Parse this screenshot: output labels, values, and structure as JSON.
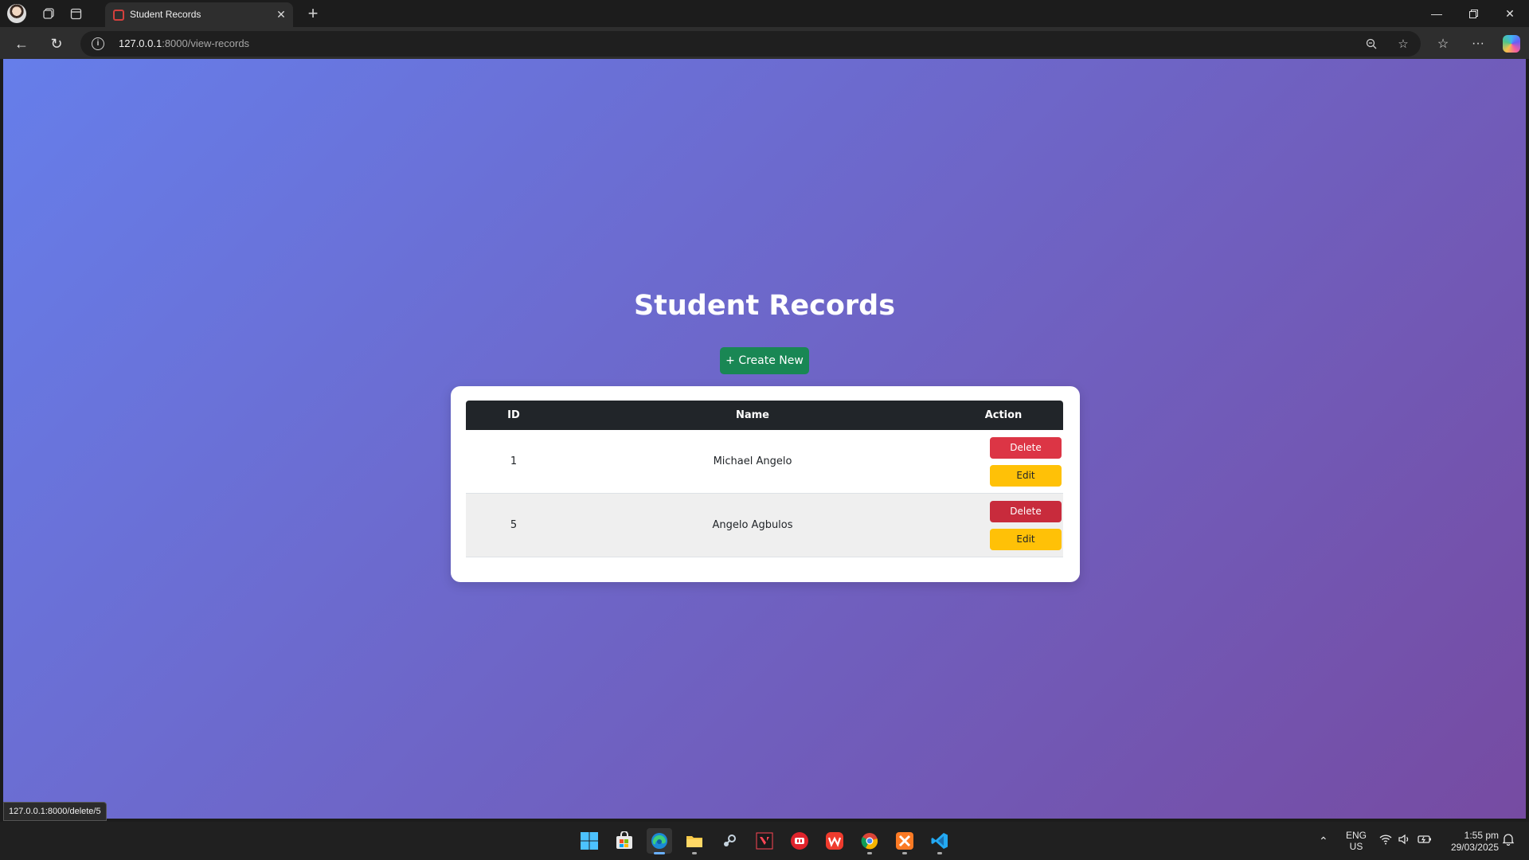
{
  "browser": {
    "tab": {
      "title": "Student Records"
    },
    "url": {
      "host": "127.0.0.1",
      "path": ":8000/view-records"
    }
  },
  "page": {
    "title": "Student Records",
    "create_button": "+ Create New",
    "table": {
      "headers": {
        "id": "ID",
        "name": "Name",
        "action": "Action"
      },
      "rows": [
        {
          "id": "1",
          "name": "Michael Angelo",
          "delete": "Delete",
          "edit": "Edit"
        },
        {
          "id": "5",
          "name": "Angelo Agbulos",
          "delete": "Delete",
          "edit": "Edit"
        }
      ]
    },
    "status_url": "127.0.0.1:8000/delete/5"
  },
  "taskbar": {
    "language": {
      "line1": "ENG",
      "line2": "US"
    },
    "time": "1:55 pm",
    "date": "29/03/2025"
  },
  "colors": {
    "gradient_start": "#667eea",
    "gradient_end": "#764ba2",
    "create": "#198754",
    "delete": "#dc3545",
    "edit": "#ffc107",
    "table_header": "#212529"
  }
}
